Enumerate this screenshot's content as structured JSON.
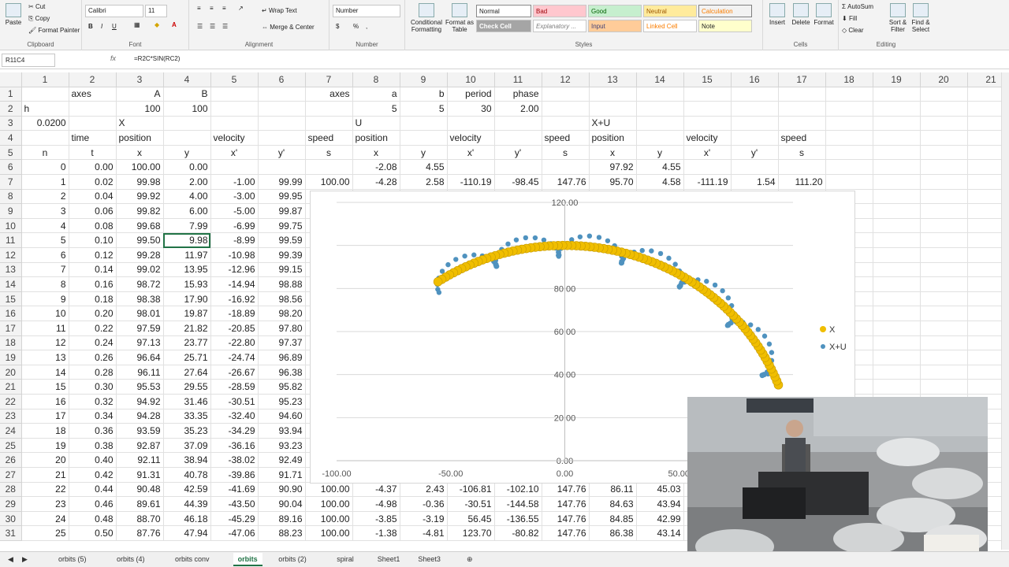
{
  "ribbon": {
    "clipboard": {
      "paste": "Paste",
      "cut": "Cut",
      "copy": "Copy",
      "format_painter": "Format Painter",
      "label": "Clipboard"
    },
    "font": {
      "name": "Calibri",
      "size": "11",
      "bold": "B",
      "italic": "I",
      "underline": "U",
      "label": "Font"
    },
    "alignment": {
      "wrap": "Wrap Text",
      "merge": "Merge & Center",
      "label": "Alignment"
    },
    "number": {
      "format": "Number",
      "currency": "$",
      "percent": "%",
      "comma": ",",
      "label": "Number"
    },
    "styles": {
      "conditional": "Conditional Formatting",
      "format_table": "Format as Table",
      "normal": "Normal",
      "bad": "Bad",
      "good": "Good",
      "neutral": "Neutral",
      "calculation": "Calculation",
      "check_cell": "Check Cell",
      "explanatory": "Explanatory ...",
      "input": "Input",
      "linked_cell": "Linked Cell",
      "note": "Note",
      "label": "Styles"
    },
    "cells": {
      "insert": "Insert",
      "delete": "Delete",
      "format": "Format",
      "label": "Cells"
    },
    "editing": {
      "autosum": "AutoSum",
      "fill": "Fill",
      "clear": "Clear",
      "sort": "Sort & Filter",
      "find": "Find & Select",
      "label": "Editing"
    }
  },
  "formula_bar": {
    "name_box": "R11C4",
    "fx": "fx",
    "formula": "=R2C*SIN(RC2)"
  },
  "columns": [
    "1",
    "2",
    "3",
    "4",
    "5",
    "6",
    "7",
    "8",
    "9",
    "10",
    "11",
    "12",
    "13",
    "14",
    "15",
    "16",
    "17",
    "18",
    "19",
    "20",
    "21"
  ],
  "rows": [
    {
      "n": "1",
      "c": [
        "",
        "axes",
        "A",
        "B",
        "",
        "",
        "axes",
        "a",
        "b",
        "period",
        "phase",
        "",
        "",
        "",
        "",
        "",
        "",
        "",
        "",
        "",
        ""
      ]
    },
    {
      "n": "2",
      "c": [
        "h",
        "",
        "100",
        "100",
        "",
        "",
        "",
        "5",
        "5",
        "30",
        "2.00",
        "",
        "",
        "",
        "",
        "",
        "",
        "",
        "",
        "",
        ""
      ]
    },
    {
      "n": "3",
      "c": [
        "0.0200",
        "",
        "X",
        "",
        "",
        "",
        "",
        "U",
        "",
        "",
        "",
        "",
        "X+U",
        "",
        "",
        "",
        "",
        "",
        "",
        "",
        ""
      ]
    },
    {
      "n": "4",
      "c": [
        "",
        "time",
        "position",
        "",
        "velocity",
        "",
        "speed",
        "position",
        "",
        "velocity",
        "",
        "speed",
        "position",
        "",
        "velocity",
        "",
        "speed",
        "",
        "",
        "",
        ""
      ]
    },
    {
      "n": "5",
      "c": [
        "n",
        "t",
        "x",
        "y",
        "x'",
        "y'",
        "s",
        "x",
        "y",
        "x'",
        "y'",
        "s",
        "x",
        "y",
        "x'",
        "y'",
        "s",
        "",
        "",
        "",
        ""
      ]
    },
    {
      "n": "6",
      "c": [
        "0",
        "0.00",
        "100.00",
        "0.00",
        "",
        "",
        "",
        "-2.08",
        "4.55",
        "",
        "",
        "",
        "97.92",
        "4.55",
        "",
        "",
        "",
        "",
        "",
        "",
        ""
      ]
    },
    {
      "n": "7",
      "c": [
        "1",
        "0.02",
        "99.98",
        "2.00",
        "-1.00",
        "99.99",
        "100.00",
        "-4.28",
        "2.58",
        "-110.19",
        "-98.45",
        "147.76",
        "95.70",
        "4.58",
        "-111.19",
        "1.54",
        "111.20",
        "",
        "",
        "",
        ""
      ]
    },
    {
      "n": "8",
      "c": [
        "2",
        "0.04",
        "99.92",
        "4.00",
        "-3.00",
        "99.95",
        "",
        "",
        "",
        "",
        "",
        "",
        "",
        "",
        "",
        "",
        "",
        "",
        "",
        "",
        ""
      ]
    },
    {
      "n": "9",
      "c": [
        "3",
        "0.06",
        "99.82",
        "6.00",
        "-5.00",
        "99.87",
        "",
        "",
        "",
        "",
        "",
        "",
        "",
        "",
        "",
        "",
        "",
        "",
        "",
        "",
        ""
      ]
    },
    {
      "n": "10",
      "c": [
        "4",
        "0.08",
        "99.68",
        "7.99",
        "-6.99",
        "99.75",
        "",
        "",
        "",
        "",
        "",
        "",
        "",
        "",
        "",
        "",
        "",
        "",
        "",
        "",
        ""
      ]
    },
    {
      "n": "11",
      "c": [
        "5",
        "0.10",
        "99.50",
        "9.98",
        "-8.99",
        "99.59",
        "",
        "",
        "",
        "",
        "",
        "",
        "",
        "",
        "",
        "",
        "",
        "",
        "",
        "",
        ""
      ]
    },
    {
      "n": "12",
      "c": [
        "6",
        "0.12",
        "99.28",
        "11.97",
        "-10.98",
        "99.39",
        "",
        "",
        "",
        "",
        "",
        "",
        "",
        "",
        "",
        "",
        "",
        "",
        "",
        "",
        ""
      ]
    },
    {
      "n": "13",
      "c": [
        "7",
        "0.14",
        "99.02",
        "13.95",
        "-12.96",
        "99.15",
        "",
        "",
        "",
        "",
        "",
        "",
        "",
        "",
        "",
        "",
        "",
        "",
        "",
        "",
        ""
      ]
    },
    {
      "n": "14",
      "c": [
        "8",
        "0.16",
        "98.72",
        "15.93",
        "-14.94",
        "98.88",
        "",
        "",
        "",
        "",
        "",
        "",
        "",
        "",
        "",
        "",
        "",
        "",
        "",
        "",
        ""
      ]
    },
    {
      "n": "15",
      "c": [
        "9",
        "0.18",
        "98.38",
        "17.90",
        "-16.92",
        "98.56",
        "",
        "",
        "",
        "",
        "",
        "",
        "",
        "",
        "",
        "",
        "",
        "",
        "",
        "",
        ""
      ]
    },
    {
      "n": "16",
      "c": [
        "10",
        "0.20",
        "98.01",
        "19.87",
        "-18.89",
        "98.20",
        "",
        "",
        "",
        "",
        "",
        "",
        "",
        "",
        "",
        "",
        "",
        "",
        "",
        "",
        ""
      ]
    },
    {
      "n": "17",
      "c": [
        "11",
        "0.22",
        "97.59",
        "21.82",
        "-20.85",
        "97.80",
        "",
        "",
        "",
        "",
        "",
        "",
        "",
        "",
        "",
        "",
        "",
        "",
        "",
        "",
        ""
      ]
    },
    {
      "n": "18",
      "c": [
        "12",
        "0.24",
        "97.13",
        "23.77",
        "-22.80",
        "97.37",
        "",
        "",
        "",
        "",
        "",
        "",
        "",
        "",
        "",
        "",
        "",
        "",
        "",
        "",
        ""
      ]
    },
    {
      "n": "19",
      "c": [
        "13",
        "0.26",
        "96.64",
        "25.71",
        "-24.74",
        "96.89",
        "",
        "",
        "",
        "",
        "",
        "",
        "",
        "",
        "",
        "",
        "",
        "",
        "",
        "",
        ""
      ]
    },
    {
      "n": "20",
      "c": [
        "14",
        "0.28",
        "96.11",
        "27.64",
        "-26.67",
        "96.38",
        "",
        "",
        "",
        "",
        "",
        "",
        "",
        "",
        "",
        "",
        "",
        "",
        "",
        "",
        ""
      ]
    },
    {
      "n": "21",
      "c": [
        "15",
        "0.30",
        "95.53",
        "29.55",
        "-28.59",
        "95.82",
        "",
        "",
        "",
        "",
        "",
        "",
        "",
        "",
        "",
        "",
        "",
        "",
        "",
        "",
        ""
      ]
    },
    {
      "n": "22",
      "c": [
        "16",
        "0.32",
        "94.92",
        "31.46",
        "-30.51",
        "95.23",
        "",
        "",
        "",
        "",
        "",
        "",
        "",
        "",
        "",
        "",
        "",
        "",
        "",
        "",
        ""
      ]
    },
    {
      "n": "23",
      "c": [
        "17",
        "0.34",
        "94.28",
        "33.35",
        "-32.40",
        "94.60",
        "",
        "",
        "",
        "",
        "",
        "",
        "",
        "",
        "",
        "",
        "",
        "",
        "",
        "",
        ""
      ]
    },
    {
      "n": "24",
      "c": [
        "18",
        "0.36",
        "93.59",
        "35.23",
        "-34.29",
        "93.94",
        "",
        "",
        "",
        "",
        "",
        "",
        "",
        "",
        "",
        "",
        "",
        "",
        "",
        "",
        ""
      ]
    },
    {
      "n": "25",
      "c": [
        "19",
        "0.38",
        "92.87",
        "37.09",
        "-36.16",
        "93.23",
        "",
        "",
        "",
        "",
        "",
        "",
        "",
        "",
        "",
        "",
        "",
        "",
        "",
        "",
        ""
      ]
    },
    {
      "n": "26",
      "c": [
        "20",
        "0.40",
        "92.11",
        "38.94",
        "-38.02",
        "92.49",
        "",
        "",
        "",
        "",
        "",
        "",
        "",
        "",
        "",
        "",
        "",
        "",
        "",
        "",
        ""
      ]
    },
    {
      "n": "27",
      "c": [
        "21",
        "0.42",
        "91.31",
        "40.78",
        "-39.86",
        "91.71",
        "",
        "",
        "",
        "",
        "",
        "",
        "",
        "",
        "",
        "",
        "",
        "",
        "",
        "",
        ""
      ]
    },
    {
      "n": "28",
      "c": [
        "22",
        "0.44",
        "90.48",
        "42.59",
        "-41.69",
        "90.90",
        "100.00",
        "-4.37",
        "2.43",
        "-106.81",
        "-102.10",
        "147.76",
        "86.11",
        "45.03",
        "",
        "",
        "",
        "",
        "",
        "",
        ""
      ]
    },
    {
      "n": "29",
      "c": [
        "23",
        "0.46",
        "89.61",
        "44.39",
        "-43.50",
        "90.04",
        "100.00",
        "-4.98",
        "-0.36",
        "-30.51",
        "-144.58",
        "147.76",
        "84.63",
        "43.94",
        "",
        "",
        "",
        "",
        "",
        "",
        ""
      ]
    },
    {
      "n": "30",
      "c": [
        "24",
        "0.48",
        "88.70",
        "46.18",
        "-45.29",
        "89.16",
        "100.00",
        "-3.85",
        "-3.19",
        "56.45",
        "-136.55",
        "147.76",
        "84.85",
        "42.99",
        "",
        "",
        "",
        "",
        "",
        "",
        ""
      ]
    },
    {
      "n": "31",
      "c": [
        "25",
        "0.50",
        "87.76",
        "47.94",
        "-47.06",
        "88.23",
        "100.00",
        "-1.38",
        "-4.81",
        "123.70",
        "-80.82",
        "147.76",
        "86.38",
        "43.14",
        "",
        "",
        "",
        "",
        "",
        "",
        ""
      ]
    }
  ],
  "chart_data": {
    "type": "scatter",
    "xlim": [
      -100,
      100
    ],
    "ylim": [
      0,
      120
    ],
    "x_ticks": [
      "-100.00",
      "-50.00",
      "0.00",
      "50.00",
      "100.00"
    ],
    "y_ticks": [
      "0.00",
      "20.00",
      "40.00",
      "60.00",
      "80.00",
      "100.00",
      "120.00"
    ],
    "legend_position": "right",
    "series": [
      {
        "name": "X",
        "color": "#f0be00",
        "radius_param": 100,
        "t_start": 0.0,
        "t_end": 2.0
      },
      {
        "name": "X+U",
        "color": "#4f92bf"
      }
    ]
  },
  "sheet_tabs": [
    "orbits (5)",
    "orbits (4)",
    "orbits conv",
    "orbits",
    "orbits (2)",
    "spiral",
    "Sheet1",
    "Sheet3"
  ],
  "active_tab": "orbits"
}
